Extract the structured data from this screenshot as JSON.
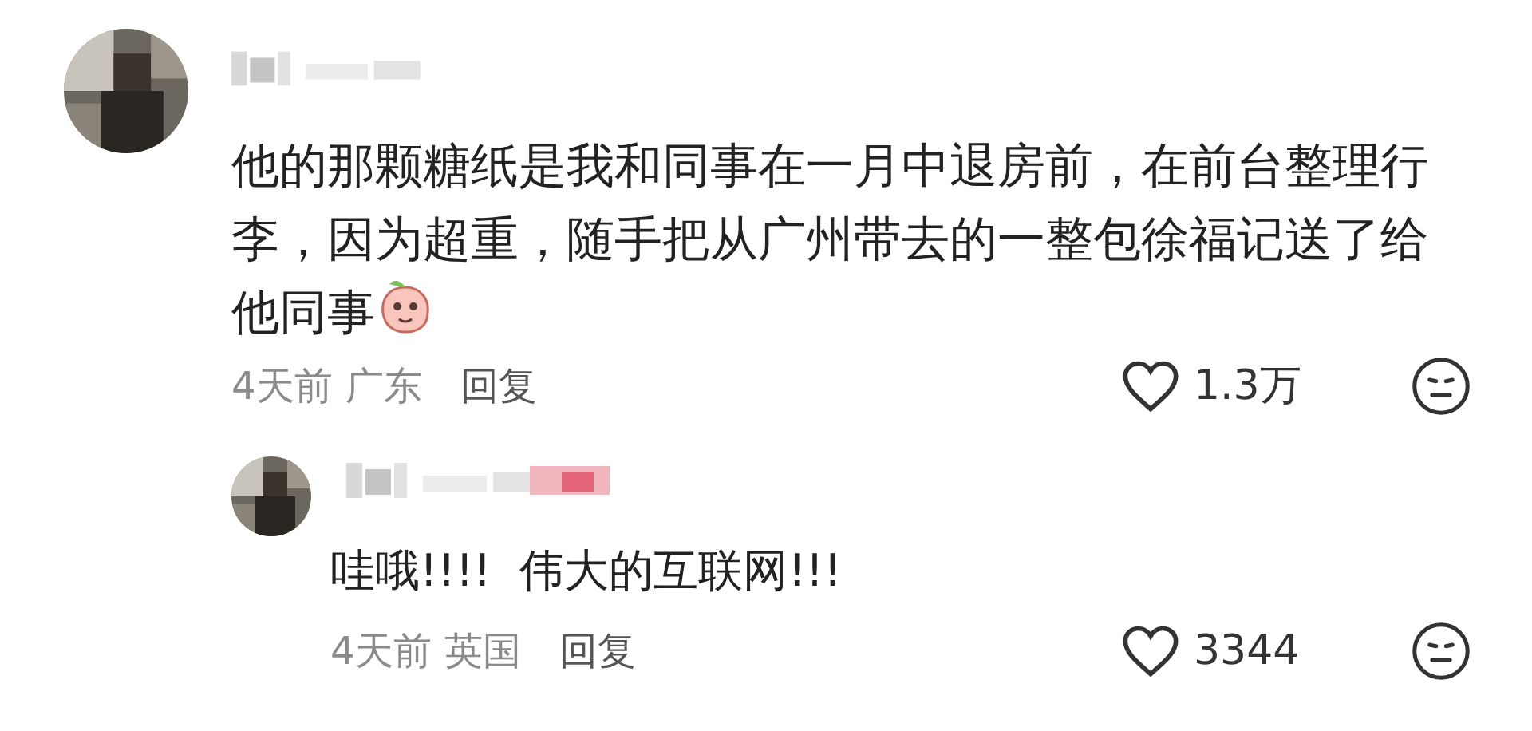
{
  "comments": [
    {
      "text": "他的那颗糖纸是我和同事在一月中退房前，在前台整理行李，因为超重，随手把从广州带去的一整包徐福记送了给他同事",
      "time": "4天前",
      "location": "广东",
      "reply_label": "回复",
      "likes": "1.3万",
      "has_emoji": true,
      "replies": [
        {
          "text": "哇哦!!!!  伟大的互联网!!!",
          "time": "4天前",
          "location": "英国",
          "reply_label": "回复",
          "likes": "3344",
          "has_emoji": false
        }
      ]
    }
  ]
}
